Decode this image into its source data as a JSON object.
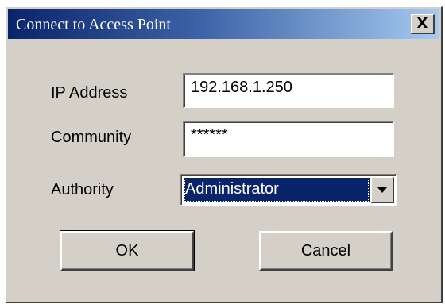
{
  "window": {
    "title": "Connect to Access Point",
    "close_glyph": "X"
  },
  "form": {
    "ip_label": "IP Address",
    "ip_value": "192.168.1.250",
    "community_label": "Community",
    "community_value": "******",
    "authority_label": "Authority",
    "authority_selected": "Administrator"
  },
  "buttons": {
    "ok_label": "OK",
    "cancel_label": "Cancel"
  },
  "icons": {
    "close": "close-icon",
    "dropdown": "chevron-down-icon"
  },
  "colors": {
    "titlebar_start": "#0a246a",
    "titlebar_end": "#a6caf0",
    "face": "#d4d0c8",
    "selection": "#0a246a"
  }
}
